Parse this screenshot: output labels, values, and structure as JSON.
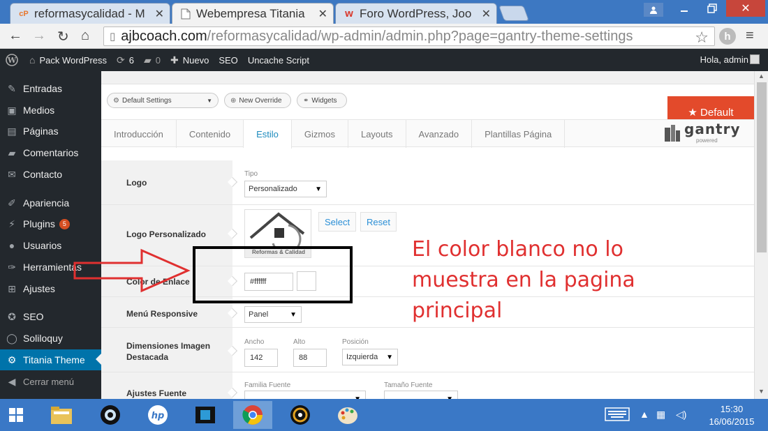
{
  "browser": {
    "tabs": [
      {
        "title": "reformasycalidad - M",
        "favicon": "cP",
        "favicon_color": "#e8772e"
      },
      {
        "title": "Webempresa Titania",
        "favicon": "page",
        "active": true
      },
      {
        "title": "Foro WordPress, Joo",
        "favicon": "w",
        "favicon_color": "#d9372b"
      }
    ],
    "url_host": "ajbcoach.com",
    "url_path": "/reformasycalidad/wp-admin/admin.php?page=gantry-theme-settings",
    "extension_letter": "h"
  },
  "adminbar": {
    "site": "Pack WordPress",
    "updates": "6",
    "comments": "0",
    "new_label": "Nuevo",
    "seo": "SEO",
    "uncache": "Uncache Script",
    "howdy": "Hola, admin"
  },
  "menu": {
    "items": [
      {
        "label": "Entradas",
        "icon": "pin-icon"
      },
      {
        "label": "Medios",
        "icon": "media-icon"
      },
      {
        "label": "Páginas",
        "icon": "pages-icon"
      },
      {
        "label": "Comentarios",
        "icon": "comments-icon"
      },
      {
        "label": "Contacto",
        "icon": "mail-icon"
      },
      {
        "label": "Apariencia",
        "icon": "brush-icon"
      },
      {
        "label": "Plugins",
        "icon": "plug-icon",
        "badge": "5"
      },
      {
        "label": "Usuarios",
        "icon": "user-icon"
      },
      {
        "label": "Herramientas",
        "icon": "wrench-icon"
      },
      {
        "label": "Ajustes",
        "icon": "settings-icon"
      },
      {
        "label": "SEO",
        "icon": "seo-icon"
      },
      {
        "label": "Soliloquy",
        "icon": "circle-icon"
      },
      {
        "label": "Titania Theme",
        "icon": "gear-icon",
        "current": true
      },
      {
        "label": "Cerrar menú",
        "icon": "collapse-icon"
      }
    ]
  },
  "gantry": {
    "settings_select": "Default Settings",
    "new_override": "New Override",
    "widgets": "Widgets",
    "default_button": "★ Default",
    "tabs": [
      "Introducción",
      "Contenido",
      "Estilo",
      "Gizmos",
      "Layouts",
      "Avanzado",
      "Plantillas Página"
    ],
    "active_tab": "Estilo",
    "logo_text": "gantry",
    "logo_sub": "powered"
  },
  "settings": {
    "logo_label": "Logo",
    "logo_type_sub": "Tipo",
    "logo_type_value": "Personalizado",
    "logo_custom_label": "Logo Personalizado",
    "logo_image_caption": "Reformas & Calidad",
    "select_btn": "Select",
    "reset_btn": "Reset",
    "link_color_label": "Color de Enlace",
    "link_color_value": "#ffffff",
    "menu_responsive_label": "Menú Responsive",
    "menu_responsive_value": "Panel",
    "featured_label": "Dimensiones Imagen Destacada",
    "width_sub": "Ancho",
    "width_value": "142",
    "height_sub": "Alto",
    "height_value": "88",
    "position_sub": "Posición",
    "position_value": "Izquierda",
    "font_label": "Ajustes Fuente",
    "font_family_sub": "Familia Fuente",
    "font_size_sub": "Tamaño Fuente"
  },
  "annotation": {
    "text": "El color blanco no lo muestra en la pagina principal",
    "color": "#e03030"
  },
  "taskbar": {
    "time": "15:30",
    "date": "16/06/2015"
  }
}
